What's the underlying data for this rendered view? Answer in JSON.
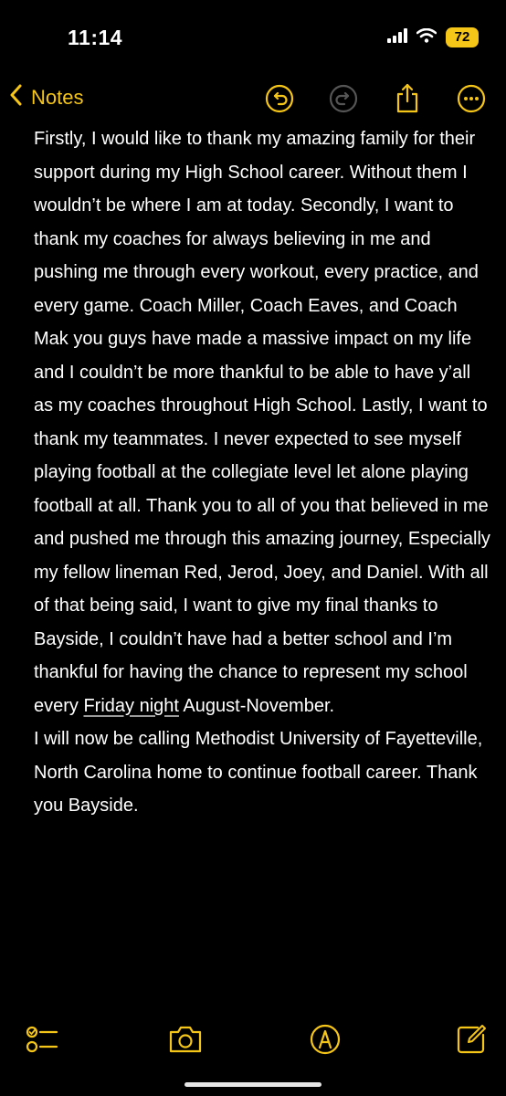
{
  "status": {
    "time": "11:14",
    "battery": "72"
  },
  "nav": {
    "back_label": "Notes"
  },
  "note": {
    "part1": "Firstly, I would like to thank my amazing family for their support during my High School career. Without them I wouldn’t be where I am at today. Secondly, I want to thank my coaches for always believing in me and pushing me through every workout, every practice, and every game. Coach Miller, Coach Eaves, and Coach Mak you guys have made a massive impact on my life and I couldn’t be more thankful to be able to have y’all as my coaches throughout High School. Lastly, I want to thank my teammates. I never expected to see myself playing football at the collegiate level let alone playing football at all. Thank you to all of you that believed in me and pushed me through this amazing journey, Especially my fellow lineman Red, Jerod, Joey, and Daniel. With all of that being said, I want to give my final thanks to Bayside, I couldn’t have had a better school and I’m thankful for having the chance to represent my school every",
    "underlined": "Friday night",
    "part2": "August-November.",
    "paragraph2": "I will now be calling Methodist University of Fayetteville, North Carolina home to continue football career. Thank you Bayside."
  },
  "icons": {
    "undo": "undo-icon",
    "redo": "redo-icon",
    "share": "share-icon",
    "more": "more-icon",
    "checklist": "checklist-icon",
    "camera": "camera-icon",
    "markup": "markup-icon",
    "compose": "compose-icon"
  },
  "colors": {
    "accent": "#f5c518",
    "background": "#000000",
    "text": "#ffffff"
  }
}
